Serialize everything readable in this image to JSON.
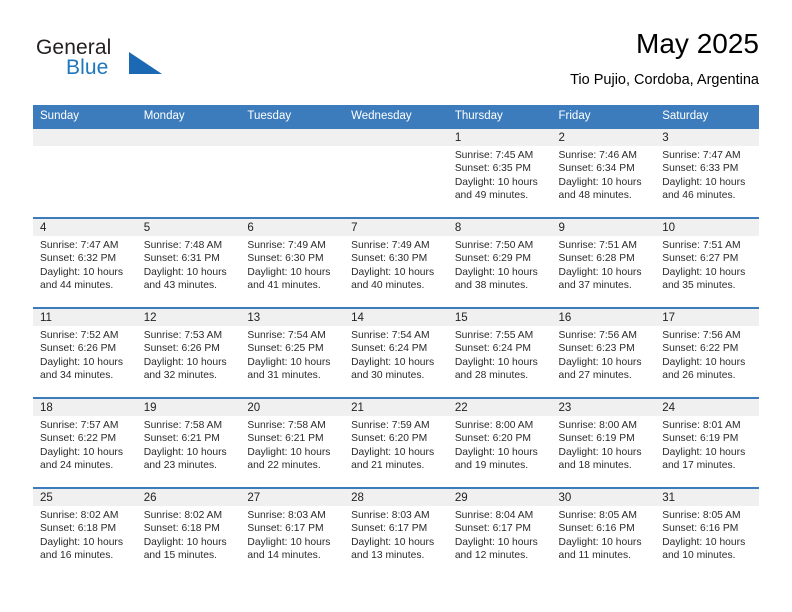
{
  "brand": {
    "name_part1": "General",
    "name_part2": "Blue",
    "triangle_color": "#1b69b3",
    "blue_color": "#1e76bd"
  },
  "header": {
    "title": "May 2025",
    "location": "Tio Pujio, Cordoba, Argentina"
  },
  "theme": {
    "header_blue": "#3c7cbd",
    "daynum_band": "#f0f0f0",
    "text": "#2b2b2b"
  },
  "weekdays": [
    "Sunday",
    "Monday",
    "Tuesday",
    "Wednesday",
    "Thursday",
    "Friday",
    "Saturday"
  ],
  "weeks": [
    [
      {
        "day": "",
        "sunrise": "",
        "sunset": "",
        "daylight1": "",
        "daylight2": "",
        "empty": true
      },
      {
        "day": "",
        "sunrise": "",
        "sunset": "",
        "daylight1": "",
        "daylight2": "",
        "empty": true
      },
      {
        "day": "",
        "sunrise": "",
        "sunset": "",
        "daylight1": "",
        "daylight2": "",
        "empty": true
      },
      {
        "day": "",
        "sunrise": "",
        "sunset": "",
        "daylight1": "",
        "daylight2": "",
        "empty": true
      },
      {
        "day": "1",
        "sunrise": "Sunrise: 7:45 AM",
        "sunset": "Sunset: 6:35 PM",
        "daylight1": "Daylight: 10 hours",
        "daylight2": "and 49 minutes."
      },
      {
        "day": "2",
        "sunrise": "Sunrise: 7:46 AM",
        "sunset": "Sunset: 6:34 PM",
        "daylight1": "Daylight: 10 hours",
        "daylight2": "and 48 minutes."
      },
      {
        "day": "3",
        "sunrise": "Sunrise: 7:47 AM",
        "sunset": "Sunset: 6:33 PM",
        "daylight1": "Daylight: 10 hours",
        "daylight2": "and 46 minutes."
      }
    ],
    [
      {
        "day": "4",
        "sunrise": "Sunrise: 7:47 AM",
        "sunset": "Sunset: 6:32 PM",
        "daylight1": "Daylight: 10 hours",
        "daylight2": "and 44 minutes."
      },
      {
        "day": "5",
        "sunrise": "Sunrise: 7:48 AM",
        "sunset": "Sunset: 6:31 PM",
        "daylight1": "Daylight: 10 hours",
        "daylight2": "and 43 minutes."
      },
      {
        "day": "6",
        "sunrise": "Sunrise: 7:49 AM",
        "sunset": "Sunset: 6:30 PM",
        "daylight1": "Daylight: 10 hours",
        "daylight2": "and 41 minutes."
      },
      {
        "day": "7",
        "sunrise": "Sunrise: 7:49 AM",
        "sunset": "Sunset: 6:30 PM",
        "daylight1": "Daylight: 10 hours",
        "daylight2": "and 40 minutes."
      },
      {
        "day": "8",
        "sunrise": "Sunrise: 7:50 AM",
        "sunset": "Sunset: 6:29 PM",
        "daylight1": "Daylight: 10 hours",
        "daylight2": "and 38 minutes."
      },
      {
        "day": "9",
        "sunrise": "Sunrise: 7:51 AM",
        "sunset": "Sunset: 6:28 PM",
        "daylight1": "Daylight: 10 hours",
        "daylight2": "and 37 minutes."
      },
      {
        "day": "10",
        "sunrise": "Sunrise: 7:51 AM",
        "sunset": "Sunset: 6:27 PM",
        "daylight1": "Daylight: 10 hours",
        "daylight2": "and 35 minutes."
      }
    ],
    [
      {
        "day": "11",
        "sunrise": "Sunrise: 7:52 AM",
        "sunset": "Sunset: 6:26 PM",
        "daylight1": "Daylight: 10 hours",
        "daylight2": "and 34 minutes."
      },
      {
        "day": "12",
        "sunrise": "Sunrise: 7:53 AM",
        "sunset": "Sunset: 6:26 PM",
        "daylight1": "Daylight: 10 hours",
        "daylight2": "and 32 minutes."
      },
      {
        "day": "13",
        "sunrise": "Sunrise: 7:54 AM",
        "sunset": "Sunset: 6:25 PM",
        "daylight1": "Daylight: 10 hours",
        "daylight2": "and 31 minutes."
      },
      {
        "day": "14",
        "sunrise": "Sunrise: 7:54 AM",
        "sunset": "Sunset: 6:24 PM",
        "daylight1": "Daylight: 10 hours",
        "daylight2": "and 30 minutes."
      },
      {
        "day": "15",
        "sunrise": "Sunrise: 7:55 AM",
        "sunset": "Sunset: 6:24 PM",
        "daylight1": "Daylight: 10 hours",
        "daylight2": "and 28 minutes."
      },
      {
        "day": "16",
        "sunrise": "Sunrise: 7:56 AM",
        "sunset": "Sunset: 6:23 PM",
        "daylight1": "Daylight: 10 hours",
        "daylight2": "and 27 minutes."
      },
      {
        "day": "17",
        "sunrise": "Sunrise: 7:56 AM",
        "sunset": "Sunset: 6:22 PM",
        "daylight1": "Daylight: 10 hours",
        "daylight2": "and 26 minutes."
      }
    ],
    [
      {
        "day": "18",
        "sunrise": "Sunrise: 7:57 AM",
        "sunset": "Sunset: 6:22 PM",
        "daylight1": "Daylight: 10 hours",
        "daylight2": "and 24 minutes."
      },
      {
        "day": "19",
        "sunrise": "Sunrise: 7:58 AM",
        "sunset": "Sunset: 6:21 PM",
        "daylight1": "Daylight: 10 hours",
        "daylight2": "and 23 minutes."
      },
      {
        "day": "20",
        "sunrise": "Sunrise: 7:58 AM",
        "sunset": "Sunset: 6:21 PM",
        "daylight1": "Daylight: 10 hours",
        "daylight2": "and 22 minutes."
      },
      {
        "day": "21",
        "sunrise": "Sunrise: 7:59 AM",
        "sunset": "Sunset: 6:20 PM",
        "daylight1": "Daylight: 10 hours",
        "daylight2": "and 21 minutes."
      },
      {
        "day": "22",
        "sunrise": "Sunrise: 8:00 AM",
        "sunset": "Sunset: 6:20 PM",
        "daylight1": "Daylight: 10 hours",
        "daylight2": "and 19 minutes."
      },
      {
        "day": "23",
        "sunrise": "Sunrise: 8:00 AM",
        "sunset": "Sunset: 6:19 PM",
        "daylight1": "Daylight: 10 hours",
        "daylight2": "and 18 minutes."
      },
      {
        "day": "24",
        "sunrise": "Sunrise: 8:01 AM",
        "sunset": "Sunset: 6:19 PM",
        "daylight1": "Daylight: 10 hours",
        "daylight2": "and 17 minutes."
      }
    ],
    [
      {
        "day": "25",
        "sunrise": "Sunrise: 8:02 AM",
        "sunset": "Sunset: 6:18 PM",
        "daylight1": "Daylight: 10 hours",
        "daylight2": "and 16 minutes."
      },
      {
        "day": "26",
        "sunrise": "Sunrise: 8:02 AM",
        "sunset": "Sunset: 6:18 PM",
        "daylight1": "Daylight: 10 hours",
        "daylight2": "and 15 minutes."
      },
      {
        "day": "27",
        "sunrise": "Sunrise: 8:03 AM",
        "sunset": "Sunset: 6:17 PM",
        "daylight1": "Daylight: 10 hours",
        "daylight2": "and 14 minutes."
      },
      {
        "day": "28",
        "sunrise": "Sunrise: 8:03 AM",
        "sunset": "Sunset: 6:17 PM",
        "daylight1": "Daylight: 10 hours",
        "daylight2": "and 13 minutes."
      },
      {
        "day": "29",
        "sunrise": "Sunrise: 8:04 AM",
        "sunset": "Sunset: 6:17 PM",
        "daylight1": "Daylight: 10 hours",
        "daylight2": "and 12 minutes."
      },
      {
        "day": "30",
        "sunrise": "Sunrise: 8:05 AM",
        "sunset": "Sunset: 6:16 PM",
        "daylight1": "Daylight: 10 hours",
        "daylight2": "and 11 minutes."
      },
      {
        "day": "31",
        "sunrise": "Sunrise: 8:05 AM",
        "sunset": "Sunset: 6:16 PM",
        "daylight1": "Daylight: 10 hours",
        "daylight2": "and 10 minutes."
      }
    ]
  ]
}
